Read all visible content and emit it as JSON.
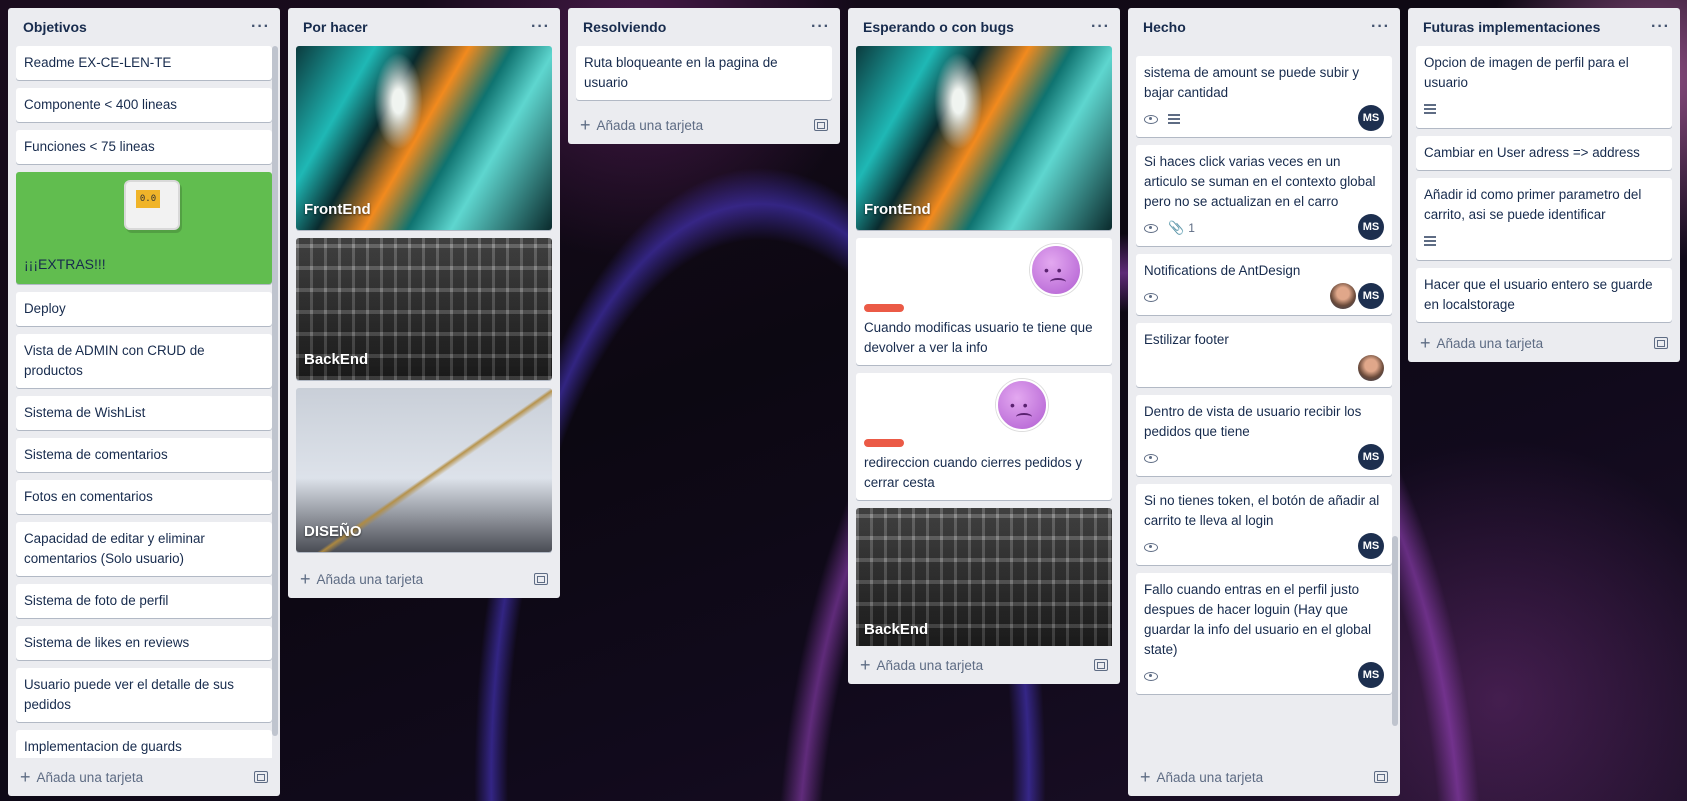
{
  "lists": [
    {
      "title": "Objetivos",
      "cards": [
        "Readme EX-CE-LEN-TE",
        "Componente < 400 lineas",
        "Funciones < 75 lineas",
        "¡¡¡EXTRAS!!!",
        "Deploy",
        "Vista de ADMIN con CRUD de productos",
        "Sistema de WishList",
        "Sistema de comentarios",
        "Fotos en comentarios",
        "Capacidad de editar y eliminar comentarios (Solo usuario)",
        "Sistema de foto de perfil",
        "Sistema de likes en reviews",
        "Usuario puede ver el detalle de sus pedidos",
        "Implementacion de guards"
      ],
      "add_label": "Añada una tarjeta"
    },
    {
      "title": "Por hacer",
      "cards": [
        "FrontEnd",
        "BackEnd",
        "DISEÑO"
      ],
      "add_label": "Añada una tarjeta"
    },
    {
      "title": "Resolviendo",
      "cards": [
        "Ruta bloqueante en la pagina de usuario"
      ],
      "add_label": "Añada una tarjeta"
    },
    {
      "title": "Esperando o con bugs",
      "cards": [
        "FrontEnd",
        "Cuando modificas usuario te tiene que devolver a ver la info",
        "redireccion cuando cierres pedidos y cerrar cesta",
        "BackEnd"
      ],
      "add_label": "Añada una tarjeta"
    },
    {
      "title": "Hecho",
      "cards": [
        "sistema de amount se puede subir y bajar cantidad",
        "Si haces click varias veces en un articulo se suman en el contexto global pero no se actualizan en el carro",
        "Notifications de AntDesign",
        "Estilizar footer",
        "Dentro de vista de usuario recibir los pedidos que tiene",
        "Si no tienes token, el botón de añadir al carrito te lleva al login",
        "Fallo cuando entras en el perfil justo despues de hacer loguin (Hay que guardar la info del usuario en el global state)"
      ],
      "attachment_count": "1",
      "member_initials": "MS",
      "add_label": "Añada una tarjeta"
    },
    {
      "title": "Futuras implementaciones",
      "cards": [
        "Opcion de imagen de perfil para el usuario",
        "Cambiar en User adress => address",
        "Añadir id como primer parametro del carrito, asi se puede identificar",
        "Hacer que el usuario entero se guarde en localstorage"
      ],
      "add_label": "Añada una tarjeta"
    }
  ],
  "icons": {
    "menu": "dots-icon",
    "add": "plus-icon",
    "template": "template-icon",
    "description": "description-icon",
    "watch": "eye-icon",
    "attachment": "paperclip-icon"
  },
  "colors": {
    "list_bg": "#ebecf0",
    "extras_green": "#61bd4f",
    "label_red": "#eb5a46",
    "avatar_navy": "#1d2f4f"
  }
}
